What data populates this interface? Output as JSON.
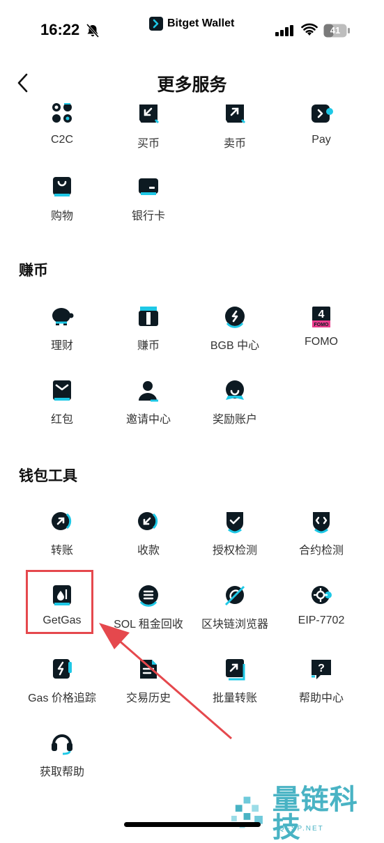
{
  "status_bar": {
    "time": "16:22",
    "battery": "41"
  },
  "brand": {
    "name": "Bitget Wallet"
  },
  "header": {
    "title": "更多服务"
  },
  "sections": [
    {
      "title": "",
      "items": [
        {
          "label": "C2C",
          "icon": "c2c-icon"
        },
        {
          "label": "买币",
          "icon": "buy-coin-icon"
        },
        {
          "label": "卖币",
          "icon": "sell-coin-icon"
        },
        {
          "label": "Pay",
          "icon": "pay-icon"
        },
        {
          "label": "购物",
          "icon": "shopping-bag-icon"
        },
        {
          "label": "银行卡",
          "icon": "bank-card-icon"
        }
      ]
    },
    {
      "title": "赚币",
      "items": [
        {
          "label": "理财",
          "icon": "piggy-bank-icon"
        },
        {
          "label": "赚币",
          "icon": "gift-icon"
        },
        {
          "label": "BGB 中心",
          "icon": "bgb-icon"
        },
        {
          "label": "FOMO",
          "icon": "fomo-icon"
        },
        {
          "label": "红包",
          "icon": "red-envelope-icon"
        },
        {
          "label": "邀请中心",
          "icon": "invite-icon"
        },
        {
          "label": "奖励账户",
          "icon": "reward-icon"
        }
      ]
    },
    {
      "title": "钱包工具",
      "items": [
        {
          "label": "转账",
          "icon": "transfer-icon"
        },
        {
          "label": "收款",
          "icon": "receive-icon"
        },
        {
          "label": "授权检测",
          "icon": "shield-check-icon"
        },
        {
          "label": "合约检测",
          "icon": "contract-check-icon"
        },
        {
          "label": "GetGas",
          "icon": "gas-pump-icon"
        },
        {
          "label": "SOL 租金回收",
          "icon": "sol-icon"
        },
        {
          "label": "区块链浏览器",
          "icon": "explorer-icon"
        },
        {
          "label": "EIP-7702",
          "icon": "eip-icon"
        },
        {
          "label": "Gas 价格追踪",
          "icon": "gas-tracker-icon"
        },
        {
          "label": "交易历史",
          "icon": "history-icon"
        },
        {
          "label": "批量转账",
          "icon": "batch-transfer-icon"
        },
        {
          "label": "帮助中心",
          "icon": "help-center-icon"
        },
        {
          "label": "获取帮助",
          "icon": "headset-icon"
        }
      ]
    }
  ],
  "fomo_badge": {
    "number": "4",
    "text": "FOMO"
  },
  "watermark": {
    "title": "量链科技",
    "sub": "QFSP.NET"
  },
  "colors": {
    "accent": "#1ec8e6",
    "icon": "#0d1a22",
    "highlight": "#e5484d"
  }
}
